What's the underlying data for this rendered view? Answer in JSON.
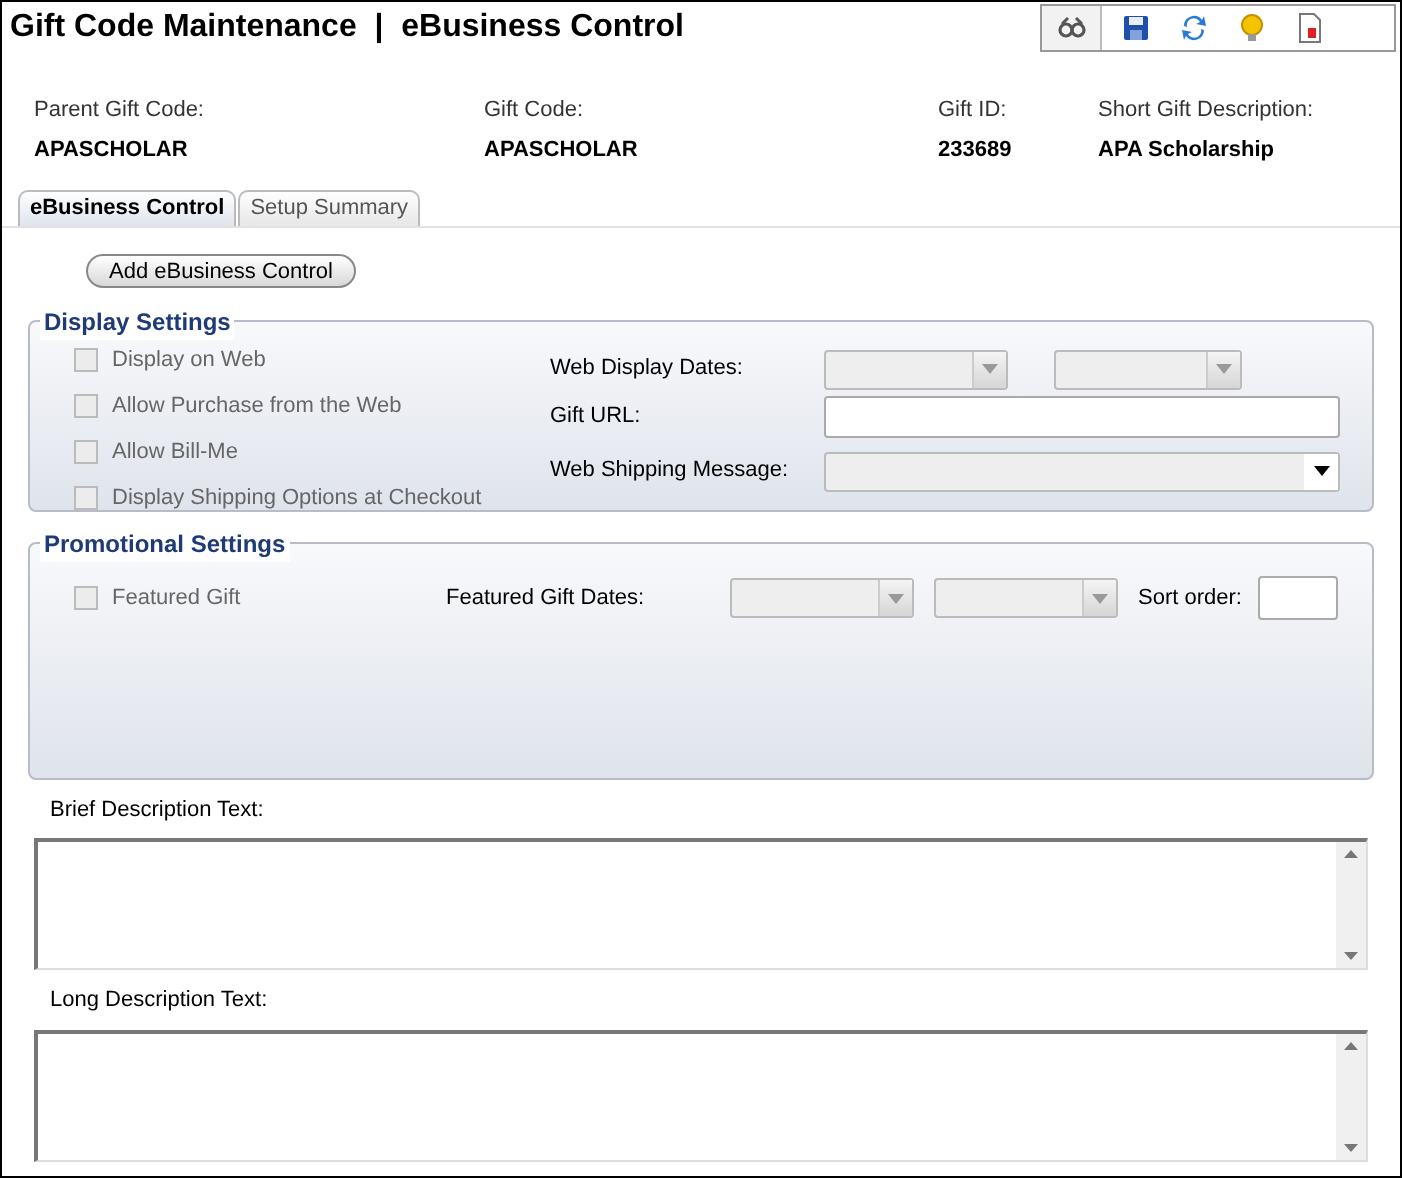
{
  "window": {
    "title": "Gift Code Maintenance  |  eBusiness Control"
  },
  "toolbar": {
    "buttons": [
      {
        "kind": "binoculars",
        "selected": true
      },
      {
        "kind": "save",
        "selected": false
      },
      {
        "kind": "refresh",
        "selected": false
      },
      {
        "kind": "bulb",
        "selected": false
      },
      {
        "kind": "report",
        "selected": false
      }
    ]
  },
  "info": [
    {
      "label": "Parent Gift Code:",
      "value": "APASCHOLAR"
    },
    {
      "label": "Gift Code:",
      "value": "APASCHOLAR"
    },
    {
      "label": "Gift ID:",
      "value": "233689"
    },
    {
      "label": "Short Gift Description:",
      "value": "APA Scholarship"
    }
  ],
  "tabs": [
    {
      "label": "eBusiness Control",
      "selected": true
    },
    {
      "label": "Setup Summary",
      "selected": false
    }
  ],
  "add_button": "Add eBusiness Control",
  "display_settings": {
    "title": "Display Settings",
    "checkboxes": [
      {
        "label": "Display on Web",
        "checked": false,
        "disabled": true
      },
      {
        "label": "Allow Purchase from the Web",
        "checked": false,
        "disabled": true
      },
      {
        "label": "Allow Bill-Me",
        "checked": false,
        "disabled": true
      },
      {
        "label": "Display Shipping Options at Checkout",
        "checked": false,
        "disabled": true
      }
    ],
    "web_display_dates": {
      "label": "Web Display Dates:",
      "disabled": true
    },
    "gift_url": {
      "label": "Gift URL:"
    },
    "web_shipping_message": {
      "label": "Web Shipping Message:"
    }
  },
  "promotional_settings": {
    "title": "Promotional Settings",
    "featured_gift": {
      "label": "Featured Gift",
      "checked": false,
      "disabled": true
    },
    "featured_gift_dates": {
      "label": "Featured Gift Dates:",
      "disabled": true
    },
    "sort_order": {
      "label": "Sort order:"
    }
  },
  "brief_description": {
    "label": "Brief Description Text:"
  },
  "long_description": {
    "label": "Long Description Text:"
  }
}
